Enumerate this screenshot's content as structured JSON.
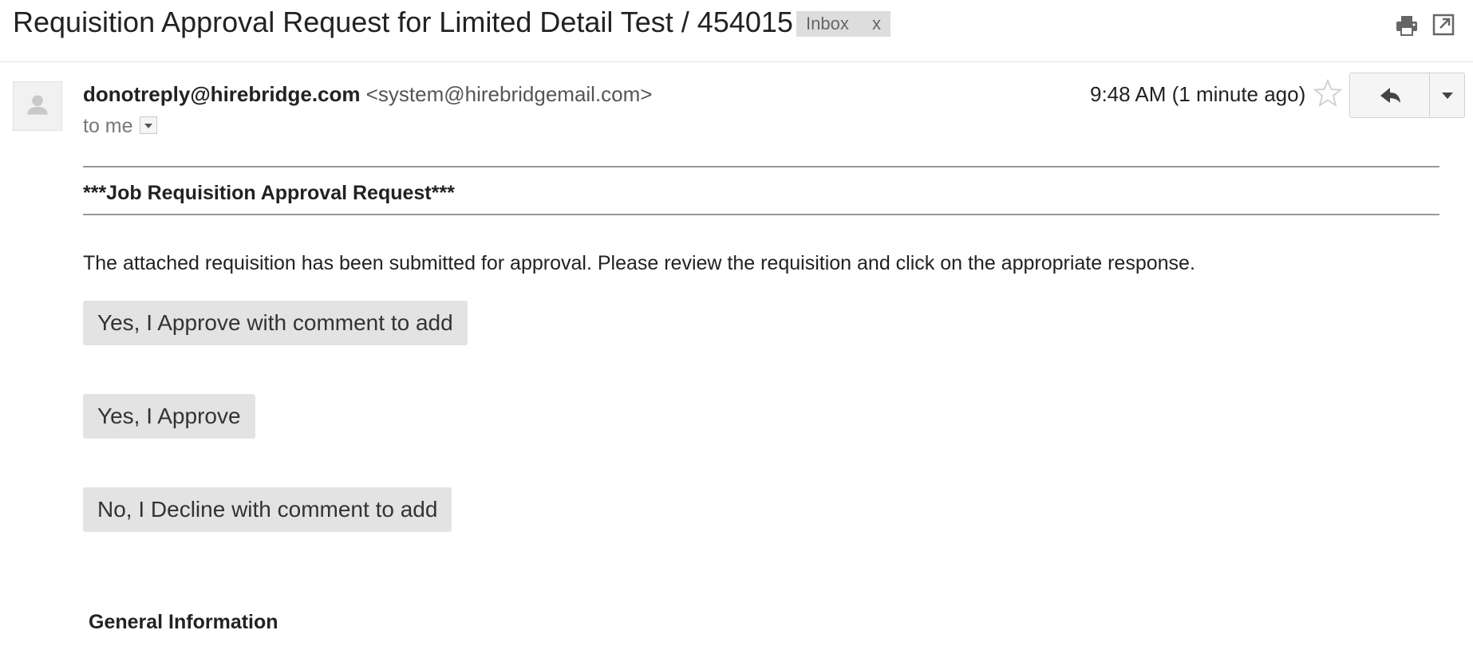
{
  "header": {
    "subject": "Requisition Approval Request for Limited Detail Test / 454015",
    "label": "Inbox",
    "label_remove": "x",
    "icons": [
      "print-icon",
      "open-in-new-window-icon"
    ]
  },
  "message": {
    "sender_name": "donotreply@hirebridge.com",
    "sender_email": "<system@hirebridgemail.com>",
    "recipient": "to me",
    "time": "9:48 AM (1 minute ago)",
    "icons": [
      "avatar-icon",
      "star-icon",
      "reply-icon",
      "more-options-icon"
    ]
  },
  "body": {
    "heading": "***Job Requisition Approval Request***",
    "intro": "The attached requisition has been submitted for approval. Please review the requisition and click on the appropriate response.",
    "buttons": [
      "Yes, I Approve with comment to add",
      "Yes, I Approve",
      "No, I Decline with comment to add"
    ],
    "section_title": "General Information"
  }
}
